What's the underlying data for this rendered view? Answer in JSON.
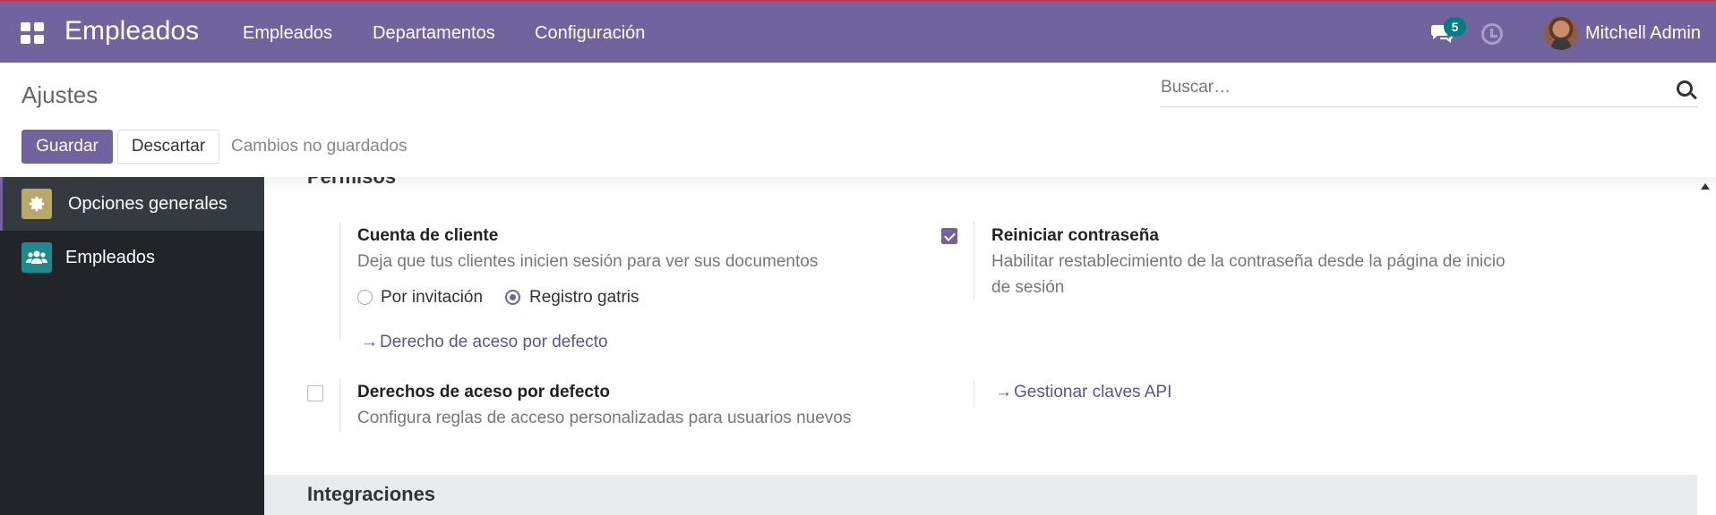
{
  "navbar": {
    "app_name": "Empleados",
    "menu": [
      "Empleados",
      "Departamentos",
      "Configuración"
    ],
    "messages_count": "5",
    "user_name": "Mitchell Admin"
  },
  "control_panel": {
    "title": "Ajustes",
    "search_placeholder": "Buscar…",
    "save_label": "Guardar",
    "discard_label": "Descartar",
    "unsaved_text": "Cambios no guardados"
  },
  "sidebar": {
    "items": [
      {
        "label": "Opciones generales",
        "icon": "gear-icon",
        "color": "#b8a86a"
      },
      {
        "label": "Empleados",
        "icon": "users-icon",
        "color": "#1f8a8c"
      }
    ]
  },
  "main": {
    "peek_section_title": "Permisos",
    "customer_account": {
      "title": "Cuenta de cliente",
      "description": "Deja que tus clientes inicien sesión para ver sus documentos",
      "options": [
        "Por invitación",
        "Registro gatris"
      ],
      "selected": "Registro gatris",
      "link": "Derecho de aceso por defecto"
    },
    "reset_password": {
      "title": "Reiniciar contraseña",
      "description_line1": "Habilitar restablecimiento de la contraseña desde la página de inicio",
      "description_line2": "de sesión",
      "checked": true
    },
    "default_access": {
      "title": "Derechos de aceso por defecto",
      "description": "Configura reglas de acceso personalizadas para usuarios nuevos",
      "checked": false
    },
    "api_keys_link": "Gestionar claves API",
    "next_section_title": "Integraciones"
  },
  "colors": {
    "brand": "#71639e",
    "sidebar_bg": "#212529",
    "badge": "#017e84"
  }
}
